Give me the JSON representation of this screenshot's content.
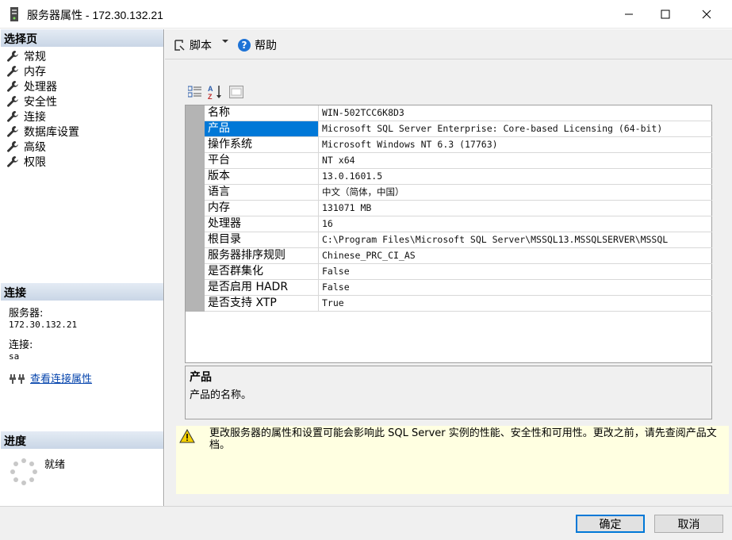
{
  "window": {
    "title": "服务器属性 - 172.30.132.21"
  },
  "left": {
    "select_page_header": "选择页",
    "nav_items": [
      "常规",
      "内存",
      "处理器",
      "安全性",
      "连接",
      "数据库设置",
      "高级",
      "权限"
    ],
    "connection_header": "连接",
    "server_label": "服务器:",
    "server_value": "172.30.132.21",
    "conn_label": "连接:",
    "conn_value": "sa",
    "view_conn_link": "查看连接属性",
    "progress_header": "进度",
    "progress_status": "就绪"
  },
  "toolbar": {
    "script_label": "脚本",
    "help_label": "帮助"
  },
  "properties": [
    {
      "name": "名称",
      "value": "WIN-502TCC6K8D3"
    },
    {
      "name": "产品",
      "value": "Microsoft SQL Server Enterprise: Core-based Licensing (64-bit)"
    },
    {
      "name": "操作系统",
      "value": "Microsoft Windows NT 6.3 (17763)"
    },
    {
      "name": "平台",
      "value": "NT x64"
    },
    {
      "name": "版本",
      "value": "13.0.1601.5"
    },
    {
      "name": "语言",
      "value": "中文（简体，中国）"
    },
    {
      "name": "内存",
      "value": "131071 MB"
    },
    {
      "name": "处理器",
      "value": "16"
    },
    {
      "name": "根目录",
      "value": "C:\\Program Files\\Microsoft SQL Server\\MSSQL13.MSSQLSERVER\\MSSQL"
    },
    {
      "name": "服务器排序规则",
      "value": "Chinese_PRC_CI_AS"
    },
    {
      "name": "是否群集化",
      "value": "False"
    },
    {
      "name": "是否启用 HADR",
      "value": "False"
    },
    {
      "name": "是否支持 XTP",
      "value": "True"
    }
  ],
  "selected_property": "产品",
  "description": {
    "title": "产品",
    "text": "产品的名称。"
  },
  "warning_text": "更改服务器的属性和设置可能会影响此 SQL Server 实例的性能、安全性和可用性。更改之前，请先查阅产品文档。",
  "footer": {
    "ok_label": "确定",
    "cancel_label": "取消"
  },
  "colors": {
    "selection": "#0078d7",
    "header_gradient": "#c9d6e6",
    "warning_bg": "#ffffe1",
    "link": "#0645ad"
  }
}
